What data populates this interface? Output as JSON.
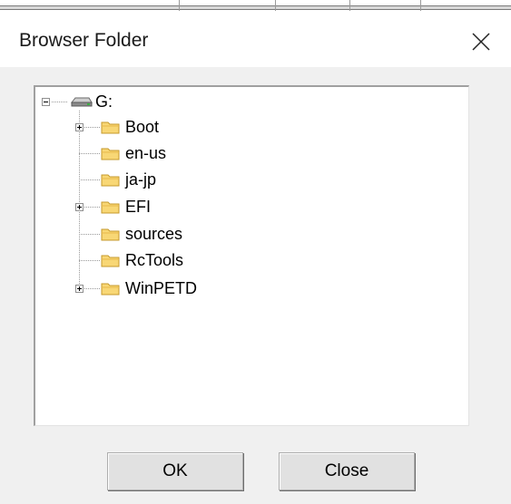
{
  "dialog": {
    "title": "Browser Folder"
  },
  "tree": {
    "root": {
      "label": "G:",
      "icon": "drive-icon",
      "expanded": true
    },
    "items": [
      {
        "label": "Boot",
        "icon": "folder-icon",
        "has_children": true
      },
      {
        "label": "en-us",
        "icon": "folder-icon",
        "has_children": false
      },
      {
        "label": "ja-jp",
        "icon": "folder-icon",
        "has_children": false
      },
      {
        "label": "EFI",
        "icon": "folder-icon",
        "has_children": true
      },
      {
        "label": "sources",
        "icon": "folder-icon",
        "has_children": false
      },
      {
        "label": "RcTools",
        "icon": "folder-icon",
        "has_children": false
      },
      {
        "label": "WinPETD",
        "icon": "folder-icon",
        "has_children": true
      }
    ]
  },
  "buttons": {
    "ok_label": "OK",
    "close_label": "Close"
  },
  "colors": {
    "folder_fill": "#f8d775",
    "folder_edge": "#c69a2c",
    "dialog_background": "#f0f0f0"
  }
}
